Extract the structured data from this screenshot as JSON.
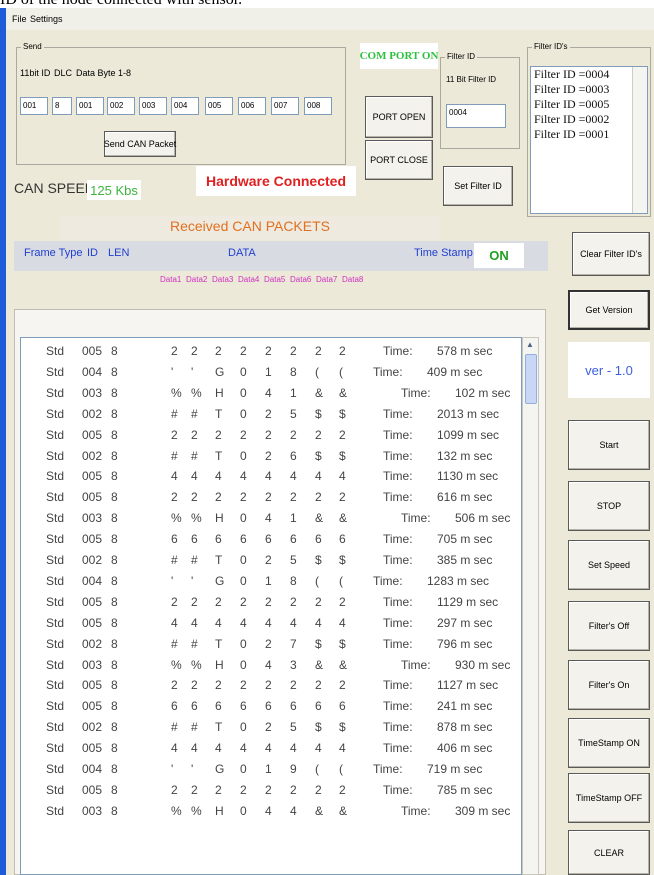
{
  "caption": "ID of the node connected with sensor.",
  "menu": [
    "File",
    "Settings"
  ],
  "send": {
    "group_label": "Send",
    "col_labels": [
      "11bit ID",
      "DLC",
      "Data Byte 1-8"
    ],
    "fields": [
      "001",
      "8",
      "001",
      "002",
      "003",
      "004",
      "005",
      "006",
      "007",
      "008"
    ],
    "button": "Send CAN Packet"
  },
  "comport": {
    "status": "COM PORT ON",
    "open": "PORT OPEN",
    "close": "PORT CLOSE"
  },
  "filter": {
    "group_label": "Filter ID",
    "sub_label": "11 Bit Filter ID",
    "value": "0004",
    "set_button": "Set Filter ID"
  },
  "filter_ids": {
    "group_label": "Filter ID's",
    "items": [
      "Filter ID =0004",
      "Filter ID =0003",
      "Filter ID =0005",
      "Filter ID =0002",
      "Filter ID =0001"
    ]
  },
  "hw_status": "Hardware Connected",
  "can_speed": {
    "label": "CAN SPEED :",
    "value": "125 Kbs"
  },
  "received_title": "Received CAN PACKETS",
  "table_header": {
    "frame_type": "Frame Type",
    "id": "ID",
    "len": "LEN",
    "data": "DATA",
    "timestamp": "Time Stamp",
    "ts_state": "ON"
  },
  "data_labels": [
    "Data1",
    "Data2",
    "Data3",
    "Data4",
    "Data5",
    "Data6",
    "Data7",
    "Data8"
  ],
  "time_label": "Time:",
  "packets": [
    {
      "type": "Std",
      "id": "005",
      "len": "8",
      "d": [
        "2",
        "2",
        "2",
        "2",
        "2",
        "2",
        "2",
        "2"
      ],
      "t": "578 m sec"
    },
    {
      "type": "Std",
      "id": "004",
      "len": "8",
      "d": [
        "'",
        "'",
        "G",
        "0",
        "1",
        "8",
        "(",
        "("
      ],
      "t": "409 m sec"
    },
    {
      "type": "Std",
      "id": "003",
      "len": "8",
      "d": [
        "%",
        "%",
        "H",
        "0",
        "4",
        "1",
        "&",
        "&"
      ],
      "t": "102 m sec"
    },
    {
      "type": "Std",
      "id": "002",
      "len": "8",
      "d": [
        "#",
        "#",
        "T",
        "0",
        "2",
        "5",
        "$",
        "$"
      ],
      "t": "2013 m sec"
    },
    {
      "type": "Std",
      "id": "005",
      "len": "8",
      "d": [
        "2",
        "2",
        "2",
        "2",
        "2",
        "2",
        "2",
        "2"
      ],
      "t": "1099 m sec"
    },
    {
      "type": "Std",
      "id": "002",
      "len": "8",
      "d": [
        "#",
        "#",
        "T",
        "0",
        "2",
        "6",
        "$",
        "$"
      ],
      "t": "132 m sec"
    },
    {
      "type": "Std",
      "id": "005",
      "len": "8",
      "d": [
        "4",
        "4",
        "4",
        "4",
        "4",
        "4",
        "4",
        "4"
      ],
      "t": "1130 m sec"
    },
    {
      "type": "Std",
      "id": "005",
      "len": "8",
      "d": [
        "2",
        "2",
        "2",
        "2",
        "2",
        "2",
        "2",
        "2"
      ],
      "t": "616 m sec"
    },
    {
      "type": "Std",
      "id": "003",
      "len": "8",
      "d": [
        "%",
        "%",
        "H",
        "0",
        "4",
        "1",
        "&",
        "&"
      ],
      "t": "506 m sec"
    },
    {
      "type": "Std",
      "id": "005",
      "len": "8",
      "d": [
        "6",
        "6",
        "6",
        "6",
        "6",
        "6",
        "6",
        "6"
      ],
      "t": "705 m sec"
    },
    {
      "type": "Std",
      "id": "002",
      "len": "8",
      "d": [
        "#",
        "#",
        "T",
        "0",
        "2",
        "5",
        "$",
        "$"
      ],
      "t": "385 m sec"
    },
    {
      "type": "Std",
      "id": "004",
      "len": "8",
      "d": [
        "'",
        "'",
        "G",
        "0",
        "1",
        "8",
        "(",
        "("
      ],
      "t": "1283 m sec"
    },
    {
      "type": "Std",
      "id": "005",
      "len": "8",
      "d": [
        "2",
        "2",
        "2",
        "2",
        "2",
        "2",
        "2",
        "2"
      ],
      "t": "1129 m sec"
    },
    {
      "type": "Std",
      "id": "005",
      "len": "8",
      "d": [
        "4",
        "4",
        "4",
        "4",
        "4",
        "4",
        "4",
        "4"
      ],
      "t": "297 m sec"
    },
    {
      "type": "Std",
      "id": "002",
      "len": "8",
      "d": [
        "#",
        "#",
        "T",
        "0",
        "2",
        "7",
        "$",
        "$"
      ],
      "t": "796 m sec"
    },
    {
      "type": "Std",
      "id": "003",
      "len": "8",
      "d": [
        "%",
        "%",
        "H",
        "0",
        "4",
        "3",
        "&",
        "&"
      ],
      "t": "930 m sec"
    },
    {
      "type": "Std",
      "id": "005",
      "len": "8",
      "d": [
        "2",
        "2",
        "2",
        "2",
        "2",
        "2",
        "2",
        "2"
      ],
      "t": "1127 m sec"
    },
    {
      "type": "Std",
      "id": "005",
      "len": "8",
      "d": [
        "6",
        "6",
        "6",
        "6",
        "6",
        "6",
        "6",
        "6"
      ],
      "t": "241 m sec"
    },
    {
      "type": "Std",
      "id": "002",
      "len": "8",
      "d": [
        "#",
        "#",
        "T",
        "0",
        "2",
        "5",
        "$",
        "$"
      ],
      "t": "878 m sec"
    },
    {
      "type": "Std",
      "id": "005",
      "len": "8",
      "d": [
        "4",
        "4",
        "4",
        "4",
        "4",
        "4",
        "4",
        "4"
      ],
      "t": "406 m sec"
    },
    {
      "type": "Std",
      "id": "004",
      "len": "8",
      "d": [
        "'",
        "'",
        "G",
        "0",
        "1",
        "9",
        "(",
        "("
      ],
      "t": "719 m sec"
    },
    {
      "type": "Std",
      "id": "005",
      "len": "8",
      "d": [
        "2",
        "2",
        "2",
        "2",
        "2",
        "2",
        "2",
        "2"
      ],
      "t": "785 m sec"
    },
    {
      "type": "Std",
      "id": "003",
      "len": "8",
      "d": [
        "%",
        "%",
        "H",
        "0",
        "4",
        "4",
        "&",
        "&"
      ],
      "t": "309 m sec"
    }
  ],
  "right_buttons": {
    "clear_filter": "Clear Filter ID's",
    "get_version": "Get Version",
    "version": "ver - 1.0",
    "start": "Start",
    "stop": "STOP",
    "set_speed": "Set Speed",
    "filters_off": "Filter's Off",
    "filters_on": "Filter's On",
    "timestamp_on": "TimeStamp ON",
    "timestamp_off": "TimeStamp OFF",
    "clear": "CLEAR"
  },
  "colors": {
    "title_bar": "#1e5bd8",
    "com_port_on": "#30c040",
    "hw_status": "#e02020",
    "can_speed": "#3cb43c",
    "received": "#e07020",
    "header_text": "#1f3fd0",
    "data_labels": "#d030c0",
    "version": "#3c5fe0"
  }
}
